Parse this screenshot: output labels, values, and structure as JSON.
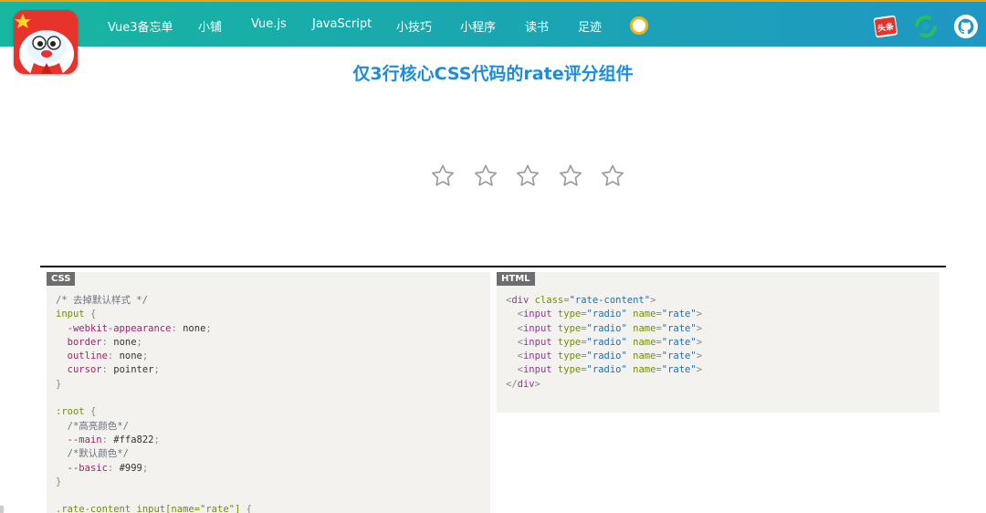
{
  "nav": {
    "items": [
      {
        "label": "Vue3备忘单"
      },
      {
        "label": "小铺"
      },
      {
        "label": "Vue.js"
      },
      {
        "label": "JavaScript"
      },
      {
        "label": "小技巧"
      },
      {
        "label": "小程序"
      },
      {
        "label": "读书"
      },
      {
        "label": "足迹"
      }
    ],
    "toutiao_label": "头条"
  },
  "page": {
    "title": "仅3行核心CSS代码的rate评分组件"
  },
  "rating": {
    "max": 5,
    "value": 0,
    "colors": {
      "main": "#ffa822",
      "basic": "#999999"
    }
  },
  "css_panel": {
    "tag": "CSS",
    "lines": [
      "/* 去掉默认样式 */",
      "input {",
      "  -webkit-appearance: none;",
      "  border: none;",
      "  outline: none;",
      "  cursor: pointer;",
      "}",
      "",
      ":root {",
      "  /*高亮颜色*/",
      "  --main: #ffa822;",
      "  /*默认颜色*/",
      "  --basic: #999;",
      "}",
      "",
      ".rate-content input[name=\"rate\"] {"
    ]
  },
  "html_panel": {
    "tag": "HTML",
    "lines": [
      "<div class=\"rate-content\">",
      "  <input type=\"radio\" name=\"rate\">",
      "  <input type=\"radio\" name=\"rate\">",
      "  <input type=\"radio\" name=\"rate\">",
      "  <input type=\"radio\" name=\"rate\">",
      "  <input type=\"radio\" name=\"rate\">",
      "</div>"
    ]
  },
  "icons": {
    "logo": "mascot-logo-icon",
    "theme": "theme-toggle-icon",
    "toutiao": "toutiao-icon",
    "refresh": "refresh-icon",
    "github": "github-icon",
    "star": "star-outline-icon"
  }
}
